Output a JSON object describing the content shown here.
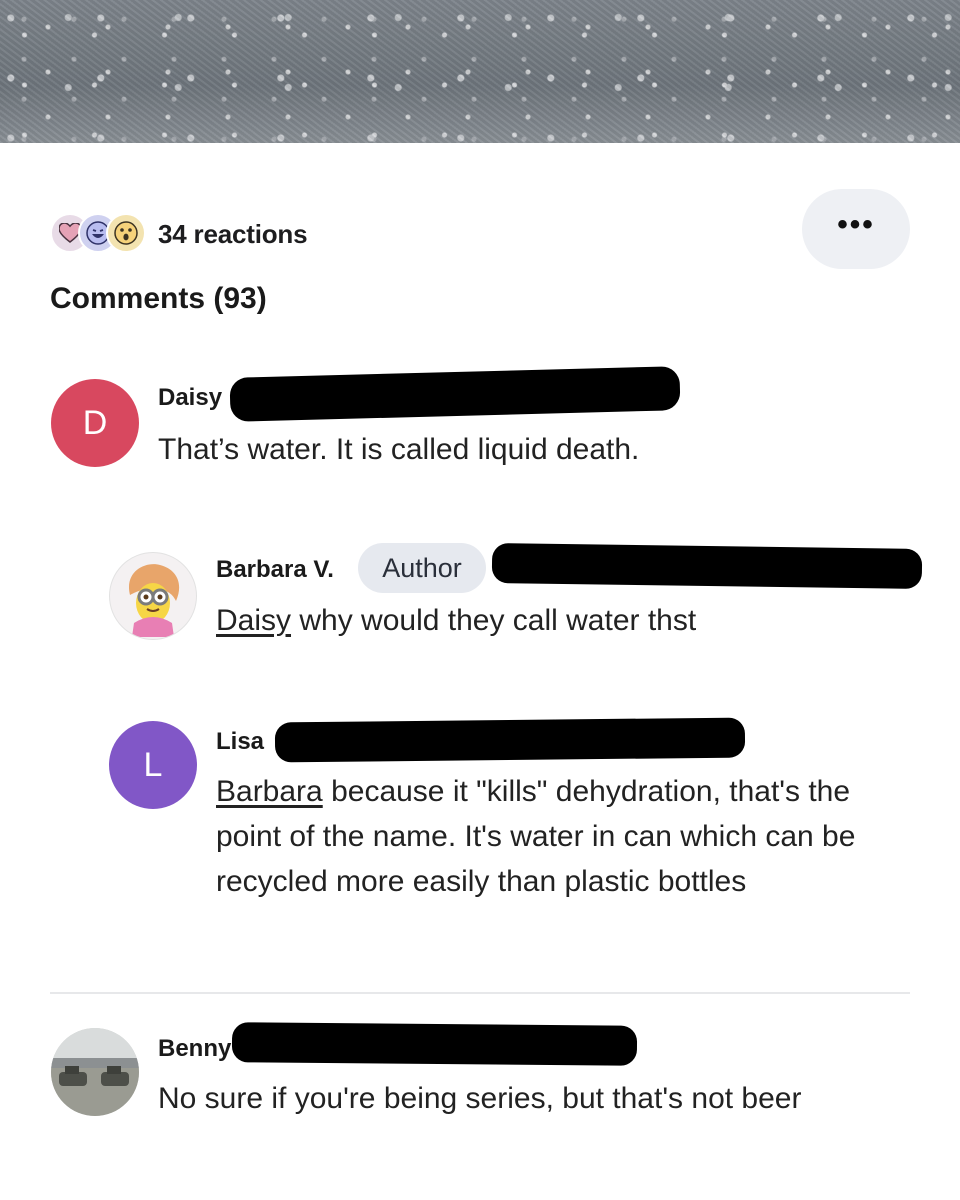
{
  "reactions": {
    "count_label": "34 reactions",
    "icons": [
      "heart-reaction-icon",
      "laugh-reaction-icon",
      "wow-reaction-icon"
    ]
  },
  "more_button": {
    "label": "•••"
  },
  "comments_header": {
    "title": "Comments (93)"
  },
  "comments": [
    {
      "initial": "D",
      "name": "Daisy",
      "avatar_color": "#d8485f",
      "text": "That’s water. It is called liquid death."
    },
    {
      "name": "Barbara V.",
      "badge": "Author",
      "mention": "Daisy",
      "text": " why would they call water thst"
    },
    {
      "initial": "L",
      "name": "Lisa",
      "avatar_color": "#8157c7",
      "mention": "Barbara",
      "text": " because it \"kills\" dehydration, that's the point of the name. It's water in can which can be recycled more easily than plastic bottles"
    },
    {
      "name": "Benny",
      "text": "No sure if you're being series, but that's not beer"
    }
  ]
}
